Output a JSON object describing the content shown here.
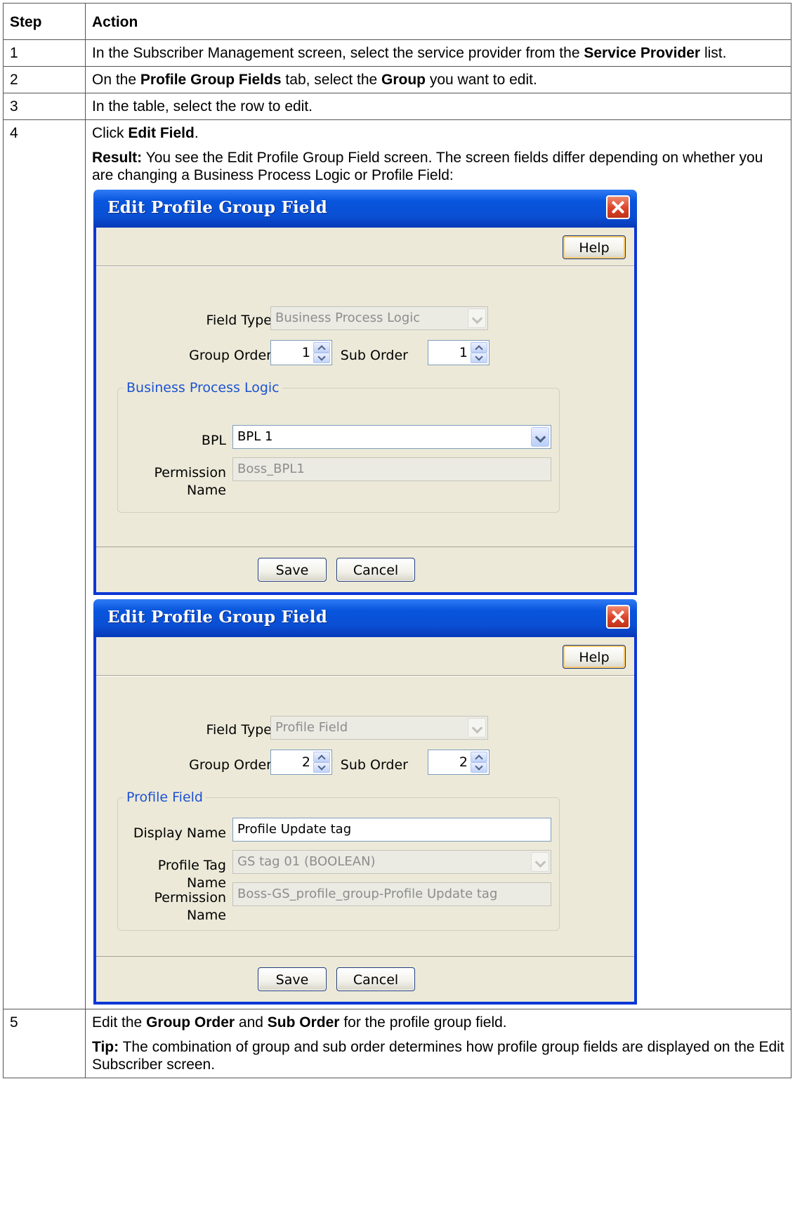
{
  "table": {
    "headers": {
      "step": "Step",
      "action": "Action"
    },
    "rows": [
      {
        "step": "1",
        "p1": {
          "a": "In the Subscriber Management screen, select the service provider from the ",
          "b1": "Service Provider",
          "c": " list."
        }
      },
      {
        "step": "2",
        "p1": {
          "a": "On the ",
          "b1": "Profile Group Fields",
          "c": " tab, select the ",
          "b2": "Group",
          "d": " you want to edit."
        }
      },
      {
        "step": "3",
        "p1": {
          "a": "In the table, select the row to edit."
        }
      },
      {
        "step": "4",
        "p1": {
          "a": "Click ",
          "b1": "Edit Field",
          "c": "."
        },
        "p2": {
          "b1": "Result:",
          "a": " You see the Edit Profile Group Field screen. The screen fields differ depending on whether you are changing a Business Process Logic or Profile Field:"
        }
      },
      {
        "step": "5",
        "p1": {
          "a": "Edit the ",
          "b1": "Group Order",
          "c": " and ",
          "b2": "Sub Order",
          "d": " for the profile group field."
        },
        "p2": {
          "b1": "Tip:",
          "a": " The combination of group and sub order determines how profile group fields are displayed on the Edit Subscriber screen."
        }
      }
    ]
  },
  "dialog_bpl": {
    "title": "Edit Profile Group Field",
    "help_label": "Help",
    "field_type_label": "Field Type",
    "field_type_value": "Business Process Logic",
    "group_order_label": "Group Order",
    "group_order_value": "1",
    "sub_order_label": "Sub Order",
    "sub_order_value": "1",
    "section_title": "Business Process Logic",
    "bpl_label": "BPL",
    "bpl_value": "BPL 1",
    "permission_label": "Permission Name",
    "permission_value": "Boss_BPL1",
    "save_label": "Save",
    "cancel_label": "Cancel"
  },
  "dialog_profile": {
    "title": "Edit Profile Group Field",
    "help_label": "Help",
    "field_type_label": "Field Type",
    "field_type_value": "Profile Field",
    "group_order_label": "Group Order",
    "group_order_value": "2",
    "sub_order_label": "Sub Order",
    "sub_order_value": "2",
    "section_title": "Profile Field",
    "display_name_label": "Display Name",
    "display_name_value": "Profile Update tag",
    "profile_tag_label": "Profile Tag Name",
    "profile_tag_value": "GS tag 01 (BOOLEAN)",
    "permission_label": "Permission Name",
    "permission_value": "Boss-GS_profile_group-Profile Update tag",
    "save_label": "Save",
    "cancel_label": "Cancel"
  }
}
